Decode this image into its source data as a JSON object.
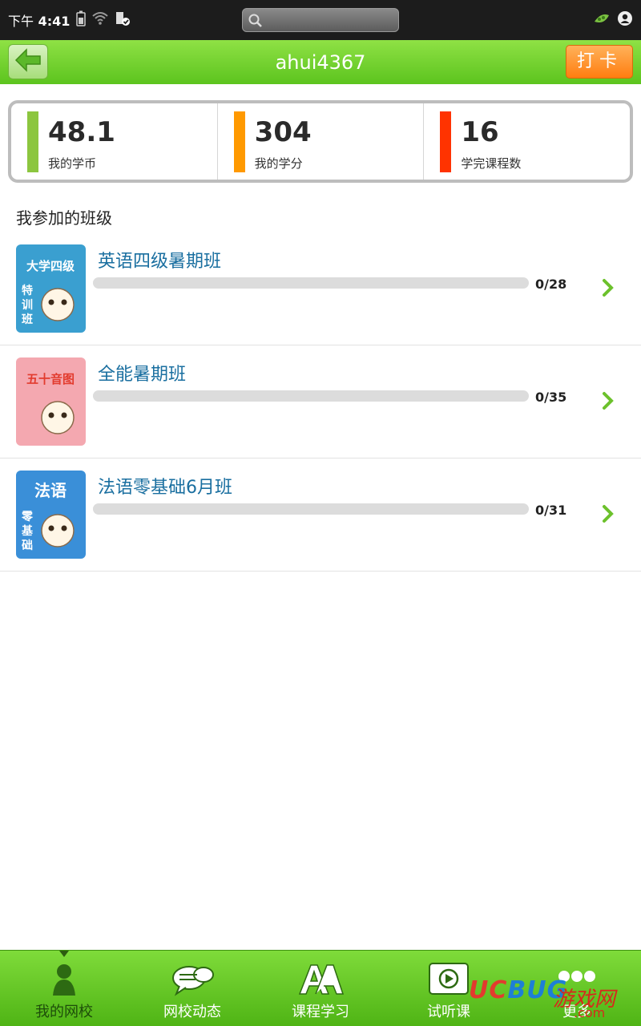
{
  "status_bar": {
    "ampm": "下午",
    "time": "4:41"
  },
  "title_bar": {
    "title": "ahui4367",
    "checkin_label": "打卡"
  },
  "stats": [
    {
      "value": "48.1",
      "label": "我的学币",
      "color": "#8cc63f"
    },
    {
      "value": "304",
      "label": "我的学分",
      "color": "#ff9900"
    },
    {
      "value": "16",
      "label": "学完课程数",
      "color": "#ff3300"
    }
  ],
  "section_title": "我参加的班级",
  "classes": [
    {
      "name": "英语四级暑期班",
      "progress_text": "0/28",
      "progress": 0,
      "thumb_top": "大学四级",
      "thumb_side": "特训班",
      "thumb_color": "#3a9fd0"
    },
    {
      "name": "全能暑期班",
      "progress_text": "0/35",
      "progress": 0,
      "thumb_top": "五十音图",
      "thumb_side": "",
      "thumb_color": "#f4a8b0"
    },
    {
      "name": "法语零基础6月班",
      "progress_text": "0/31",
      "progress": 0,
      "thumb_top": "法语",
      "thumb_side": "零基础",
      "thumb_color": "#3a8fd8"
    }
  ],
  "bottom_nav": [
    {
      "label": "我的网校",
      "icon": "person-icon",
      "active": true
    },
    {
      "label": "网校动态",
      "icon": "chat-bubbles-icon",
      "active": false
    },
    {
      "label": "课程学习",
      "icon": "letters-a-icon",
      "active": false
    },
    {
      "label": "试听课",
      "icon": "video-play-icon",
      "active": false
    },
    {
      "label": "更多",
      "icon": "more-dots-icon",
      "active": false
    }
  ],
  "watermark": {
    "uc": "UC",
    "bug": "BUG",
    "cn": "游戏网",
    "com": ".com"
  }
}
